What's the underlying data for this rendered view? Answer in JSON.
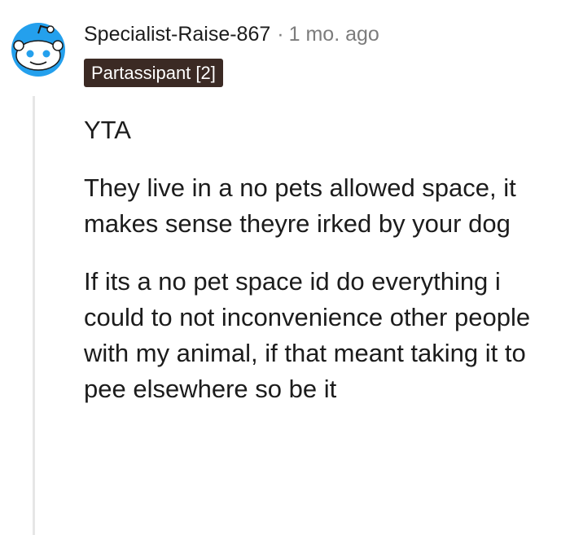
{
  "comment": {
    "username": "Specialist-Raise-867",
    "separator": "·",
    "timestamp": "1 mo. ago",
    "flair": "Partassipant [2]",
    "paragraphs": [
      "YTA",
      "They live in a no pets allowed space, it makes sense theyre irked by your dog",
      "If its a no pet space id do everything i could to not inconvenience other people with my animal, if that meant taking it to pee elsewhere so be it"
    ]
  },
  "avatar": {
    "icon": "reddit-snoo-avatar-icon",
    "color": "#24a0ed"
  },
  "colors": {
    "flair_background": "#3b2a24",
    "meta_text": "#7c7c7c",
    "thread_line": "#e6e6e6"
  }
}
